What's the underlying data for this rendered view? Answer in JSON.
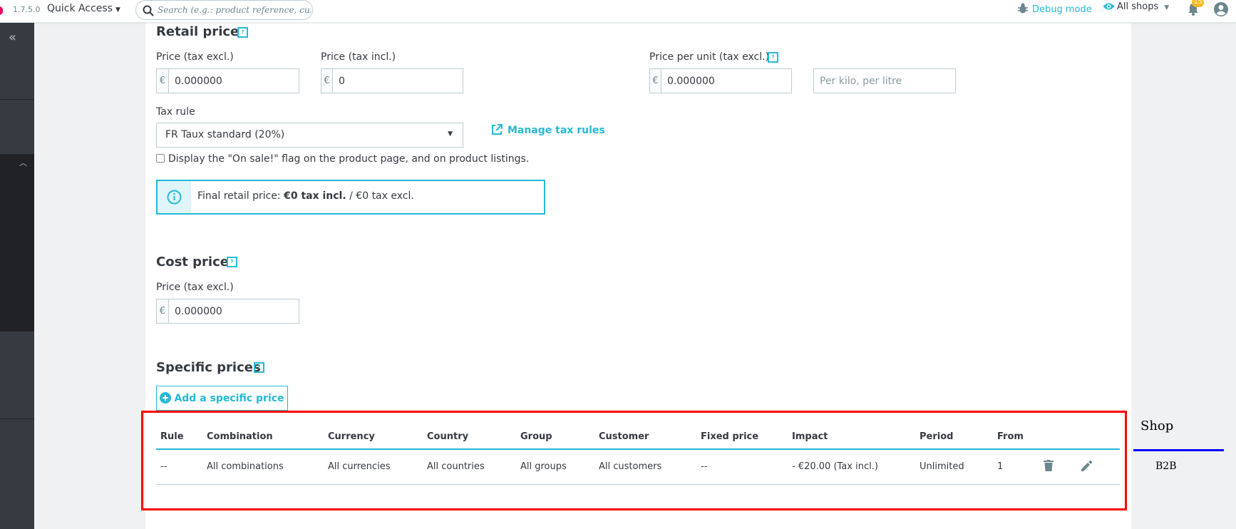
{
  "topbar": {
    "version": "1.7.5.0",
    "quick_access": "Quick Access",
    "search_placeholder": "Search (e.g.: product reference, customer name...)",
    "debug_mode": "Debug mode",
    "all_shops": "All shops",
    "notifications_count": "15",
    "accent_color": "#25b9d7",
    "badge_color": "#fbbb22"
  },
  "retail": {
    "title": "Retail price",
    "help": "?",
    "price_excl_label": "Price (tax excl.)",
    "price_excl_currency": "€",
    "price_excl_value": "0.000000",
    "price_incl_label": "Price (tax incl.)",
    "price_incl_currency": "€",
    "price_incl_value": "0",
    "unit_label": "Price per unit (tax excl.)",
    "unit_currency": "€",
    "unit_value": "0.000000",
    "unit_placeholder": "Per kilo, per litre",
    "tax_rule_label": "Tax rule",
    "tax_rule_value": "FR Taux standard (20%)",
    "manage_tax_rules": "Manage tax rules",
    "on_sale_label": "Display the \"On sale!\" flag on the product page, and on product listings.",
    "on_sale_checked": false,
    "final_prefix": "Final retail price: ",
    "final_incl": "€0 tax incl.",
    "final_excl": " / €0 tax excl."
  },
  "cost": {
    "title": "Cost price",
    "help": "?",
    "price_label": "Price (tax excl.)",
    "currency": "€",
    "value": "0.000000"
  },
  "specific": {
    "title": "Specific prices",
    "help": "?",
    "add_button": "Add a specific price",
    "columns": [
      "Rule",
      "Combination",
      "Currency",
      "Country",
      "Group",
      "Customer",
      "Fixed price",
      "Impact",
      "Period",
      "From"
    ],
    "rows": [
      [
        "--",
        "All combinations",
        "All currencies",
        "All countries",
        "All groups",
        "All customers",
        "--",
        "- €20.00 (Tax incl.)",
        "Unlimited",
        "1"
      ]
    ]
  },
  "shop_panel": {
    "title": "Shop",
    "name": "B2B"
  }
}
